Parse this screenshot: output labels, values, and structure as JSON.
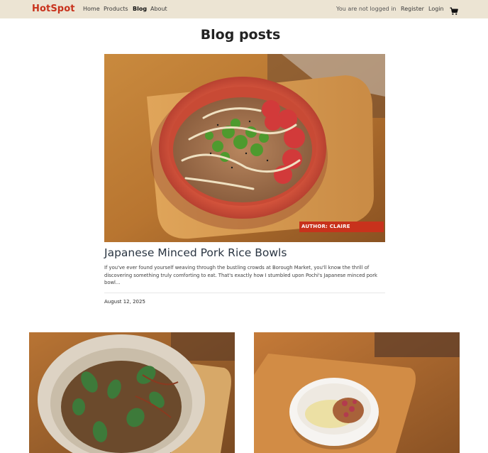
{
  "nav": {
    "brand": "HotSpot",
    "links": [
      "Home",
      "Products",
      "Blog",
      "About"
    ],
    "status": "You are not logged in",
    "register": "Register",
    "login": "Login",
    "cart_icon": "shopping-cart-icon"
  },
  "page": {
    "title": "Blog posts"
  },
  "featured": {
    "author_badge": "AUTHOR: CLAIRE",
    "title": "Japanese Minced Pork Rice Bowls",
    "excerpt": "If you've ever found yourself weaving through the bustling crowds at Borough Market, you'll know the thrill of discovering something truly comforting to eat. That's exactly how I stumbled upon Pochi's Japanese minced pork bowl...",
    "date": "August 12, 2025"
  },
  "colors": {
    "accent": "#c8321c",
    "navbar_bg": "#ece4d3"
  }
}
